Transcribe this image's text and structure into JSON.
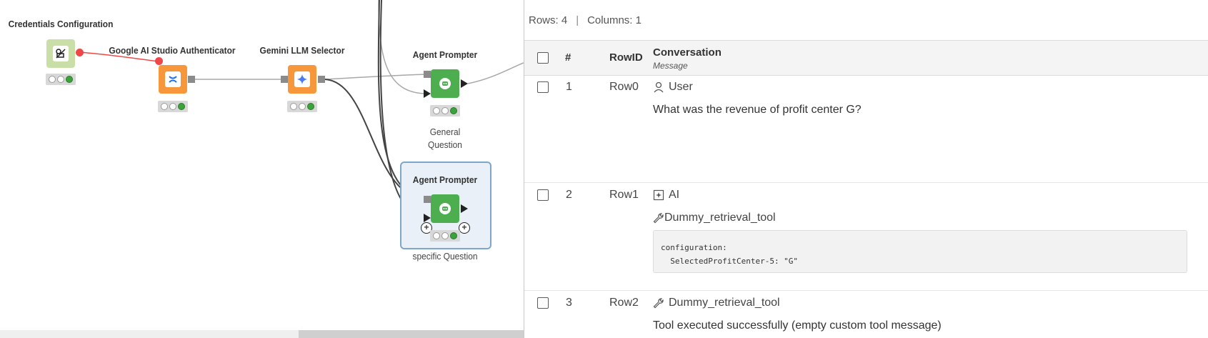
{
  "workflow": {
    "nodes": {
      "credentials": {
        "label": "Credentials Configuration",
        "icon": "credentials-icon"
      },
      "authenticator": {
        "label": "Google AI Studio Authenticator",
        "icon": "google-ai-icon"
      },
      "llm_selector": {
        "label": "Gemini LLM Selector",
        "icon": "gemini-icon"
      },
      "prompter1": {
        "label": "Agent Prompter",
        "sub": "General Question",
        "icon": "agent-icon"
      },
      "prompter2": {
        "label": "Agent Prompter",
        "sub": "specific Question",
        "icon": "agent-icon"
      }
    },
    "colors": {
      "config": "#c9dfa7",
      "connector": "#f6973c",
      "agent": "#4cae4f",
      "selected": "#7ea6cb",
      "flow_var": "#ef4747"
    }
  },
  "table": {
    "rows_label": "Rows: 4",
    "cols_label": "Columns: 1",
    "headers": {
      "index": "#",
      "rowid": "RowID",
      "col": "Conversation",
      "col_type": "Message"
    },
    "rows": [
      {
        "index": "1",
        "rowid": "Row0",
        "role": "User",
        "role_icon": "user-icon",
        "text": "What was the revenue of profit center G?"
      },
      {
        "index": "2",
        "rowid": "Row1",
        "role": "AI",
        "role_icon": "ai-icon",
        "tool": "Dummy_retrieval_tool",
        "code_line1": "configuration:",
        "code_line2": "  SelectedProfitCenter-5: \"G\""
      },
      {
        "index": "3",
        "rowid": "Row2",
        "role": "Dummy_retrieval_tool",
        "role_icon": "wrench-icon",
        "text": "Tool executed successfully (empty custom tool message)"
      }
    ]
  }
}
